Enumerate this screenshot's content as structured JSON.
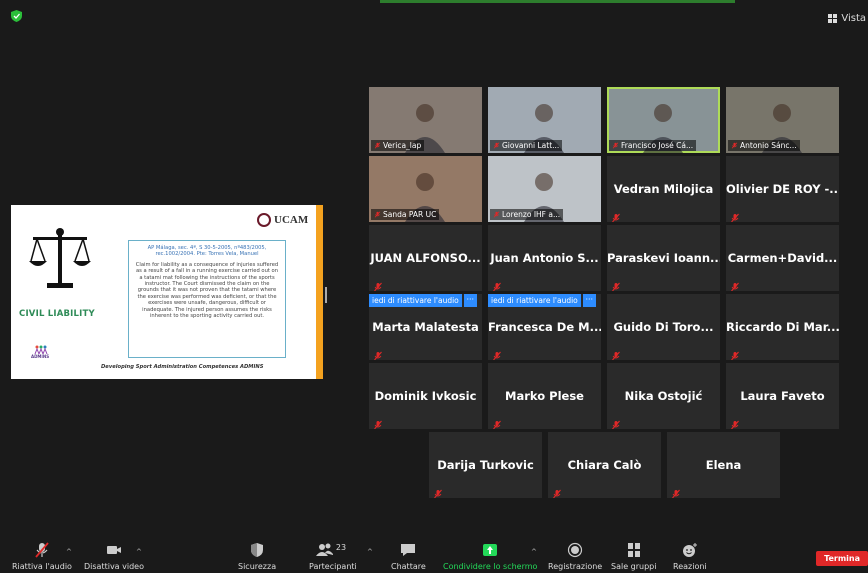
{
  "window": {
    "view_label": "Vista"
  },
  "slide": {
    "logo_text": "UCAM",
    "title": "CIVIL LIABILITY",
    "reference": "AP Málaga, sec. 4ª, S 30-5-2005, nº483/2005, rec.1002/2004. Pte: Torres Vela, Manuel",
    "body": "Claim for liability as a consequence of injuries suffered as a result of a fall in a running exercise carried out on a tatami mat following the instructions of the sports instructor. The Court dismissed the claim on the grounds that it was not proven that the tatami where the exercise was performed was deficient, or that the exercises were unsafe, dangerous, difficult or inadequate. The injured person assumes the risks inherent to the sporting activity carried out.",
    "footer": "Developing Sport Administration Competences ADMINS",
    "brand": "ADMINS"
  },
  "participants": [
    {
      "name": "Verica_lap",
      "video": true,
      "color": "#7b6f66"
    },
    {
      "name": "Giovanni Latt...",
      "video": true,
      "color": "#9aa3ad"
    },
    {
      "name": "Francisco José Cá...",
      "video": true,
      "color": "#7e8a8e",
      "active": true
    },
    {
      "name": "Antonio Sánc...",
      "video": true,
      "color": "#6d6a5e"
    },
    {
      "name": "Sanda PAR UC",
      "video": true,
      "color": "#8b6e5a"
    },
    {
      "name": "Lorenzo IHF a...",
      "video": true,
      "color": "#b9bec4"
    },
    {
      "name": "Vedran Milojica"
    },
    {
      "name": "Olivier DE ROY -..."
    },
    {
      "name": "JUAN ALFONSO..."
    },
    {
      "name": "Juan Antonio S..."
    },
    {
      "name": "Paraskevi Ioann..."
    },
    {
      "name": "Carmen+David..."
    },
    {
      "name": "Marta Malatesta",
      "banner": "iedi di riattivare l'audio"
    },
    {
      "name": "Francesca De M...",
      "banner": "iedi di riattivare l'audio"
    },
    {
      "name": "Guido Di Toro..."
    },
    {
      "name": "Riccardo Di Mar..."
    },
    {
      "name": "Dominik Ivkosic"
    },
    {
      "name": "Marko Plese"
    },
    {
      "name": "Nika Ostojić"
    },
    {
      "name": "Laura Faveto"
    },
    {
      "name": "Darija Turkovic"
    },
    {
      "name": "Chiara Calò"
    },
    {
      "name": "Elena"
    }
  ],
  "toolbar": {
    "unmute": "Riattiva l'audio",
    "stop_video": "Disattiva video",
    "security": "Sicurezza",
    "participants": "Partecipanti",
    "participants_count": "23",
    "chat": "Chattare",
    "share": "Condividere lo schermo",
    "record": "Registrazione",
    "breakout": "Sale gruppi",
    "reactions": "Reazioni",
    "end": "Termina"
  },
  "colors": {
    "accent": "#2d8cff",
    "share": "#23d959",
    "active_speaker": "#a8d84a",
    "end": "#e02828"
  }
}
